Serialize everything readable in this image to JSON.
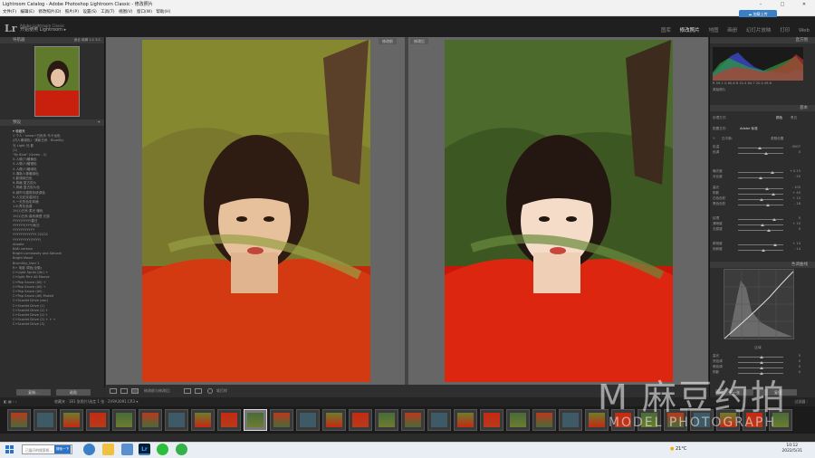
{
  "window": {
    "title": "Lightroom Catalog - Adobe Photoshop Lightroom Classic - 修改照片",
    "min": "–",
    "max": "□",
    "close": "✕"
  },
  "menu": [
    "文件(F)",
    "编辑(E)",
    "修改照片(D)",
    "照片(P)",
    "设置(S)",
    "工具(T)",
    "视图(V)",
    "窗口(W)",
    "帮助(H)"
  ],
  "cloud_button": "加载上传",
  "identity": {
    "logo": "Lr",
    "line1": "Adobe Lightroom Classic",
    "line2": "开始使用 Lightroom ▸"
  },
  "modules": [
    "图库",
    "修改照片",
    "地图",
    "画册",
    "幻灯片放映",
    "打印",
    "Web"
  ],
  "active_module": "修改照片",
  "left": {
    "navigator": "导航器",
    "nav_opts": "适合  填满  1:1  3:1",
    "presets_title": "预设",
    "presets": [
      "▾ 收藏夹",
      "1 个人 · snow+白色系 马卡龙色",
      "(内人像调色) · 清新日系 · BlueSky",
      "光 Light 光 影",
      "(1)",
      "\"fly Blue\" (Green - 2)",
      "5-人像(7)暖黄色",
      "5-人像(7)暖橙色",
      "5-人像(7)暖绿色",
      "5-清新人像暖绿色",
      "5-影调润白色",
      "6-风格 复古胶片",
      "7-风格 复古胶片色",
      "8-城市与建筑系统调色",
      "9-人文纪实高对比",
      "9-一天的色彩风格",
      "1.8-青灰色调",
      "19(1)日系·柔光 暖色",
      "19(1)日系·森系清透 光感",
      "YYYY(YYYY)春日",
      "YYYYYY(YYY)秋日",
      "YYYYYYYYYYY",
      "YYYYYYYYYYYY 22222",
      "YYYYYYYYY(YYYY)",
      "Ahodie",
      "BAD version",
      "Bright Luminosity and Saturat",
      "Bright Mood",
      "BrumSky_User 2",
      "R+ 电影 调色(全集)",
      "C+Light Spritz (Dir) +",
      "C+light Film All Mauve",
      "C+Pop Sauce (All) +",
      "C+Pop Sauce (All) +",
      "C+Pop Sauce (All) -",
      "C+Pop Sauce (All) Muted",
      "C+Scarlet Drive (exc)",
      "C+Scarlet Drive (1)",
      "C+Scarlet Drive (2) +",
      "C+Scarlet Drive (2) +",
      "C+Scarlet Drive (2) + + +",
      "C+Scarlet Drive (3)"
    ],
    "copy_btn": "复制...",
    "paste_btn": "粘贴"
  },
  "canvas": {
    "before_label": "修改前",
    "after_label": "修改后"
  },
  "toolbar": {
    "view_modes": "修改前与修改后:",
    "soft_proof": "软打样"
  },
  "right": {
    "histogram": "直方图",
    "histo_values": "R 59.1  G 60.8  B 52.4  64.7  20.4  49.6",
    "original_photo": "原始照片",
    "basic": "基本",
    "treatment_label": "处理方式:",
    "treatment_color": "颜色",
    "treatment_bw": "黑白",
    "profile_label": "配置文件:",
    "profile_value": "Adobe 标准",
    "wb_label": "白平衡:",
    "wb_value": "原照设置",
    "rows": [
      {
        "label": "色温",
        "value": "-5007"
      },
      {
        "label": "色调",
        "value": "0"
      },
      {
        "label": "曝光度",
        "value": "+ 0.15"
      },
      {
        "label": "对比度",
        "value": "- 20"
      },
      {
        "label": "高光",
        "value": "- 100"
      },
      {
        "label": "阴影",
        "value": "+ 40"
      },
      {
        "label": "白色色阶",
        "value": "+ 10"
      },
      {
        "label": "黑色色阶",
        "value": "- 18"
      },
      {
        "label": "纹理",
        "value": "0"
      },
      {
        "label": "清晰度",
        "value": "+ 10"
      },
      {
        "label": "去朦胧",
        "value": "0"
      },
      {
        "label": "鲜艳度",
        "value": "+ 14"
      },
      {
        "label": "饱和度",
        "value": "- 14"
      }
    ],
    "tone_curve": "色调曲线",
    "region": "区域",
    "curve_rows": [
      {
        "label": "高光",
        "value": "0"
      },
      {
        "label": "亮色调",
        "value": "0"
      },
      {
        "label": "暗色调",
        "value": "0"
      },
      {
        "label": "阴影",
        "value": "0"
      }
    ],
    "prev_btn": "上一张",
    "reset_btn": "复位"
  },
  "filmstrip": {
    "info": "收藏夹 · 181 张照片/选定 1 张 · 2V9A3091.CR3 ▾",
    "filter": "过滤器 :",
    "thumb_count": 30,
    "selected_index": 9
  },
  "taskbar": {
    "search_placeholder": "已展开的搜索框...",
    "search_btn": "搜索一下",
    "temp": "21°C",
    "time": "10:12",
    "date": "2022/5/31"
  },
  "watermark": {
    "line1": "M 麻豆约拍",
    "line2": "MODEL PHOTOGRAPH"
  },
  "colors": {
    "accent_blue": "#2b73c8",
    "panel_bg": "#2d2d2d",
    "canvas_bg": "#666666"
  }
}
